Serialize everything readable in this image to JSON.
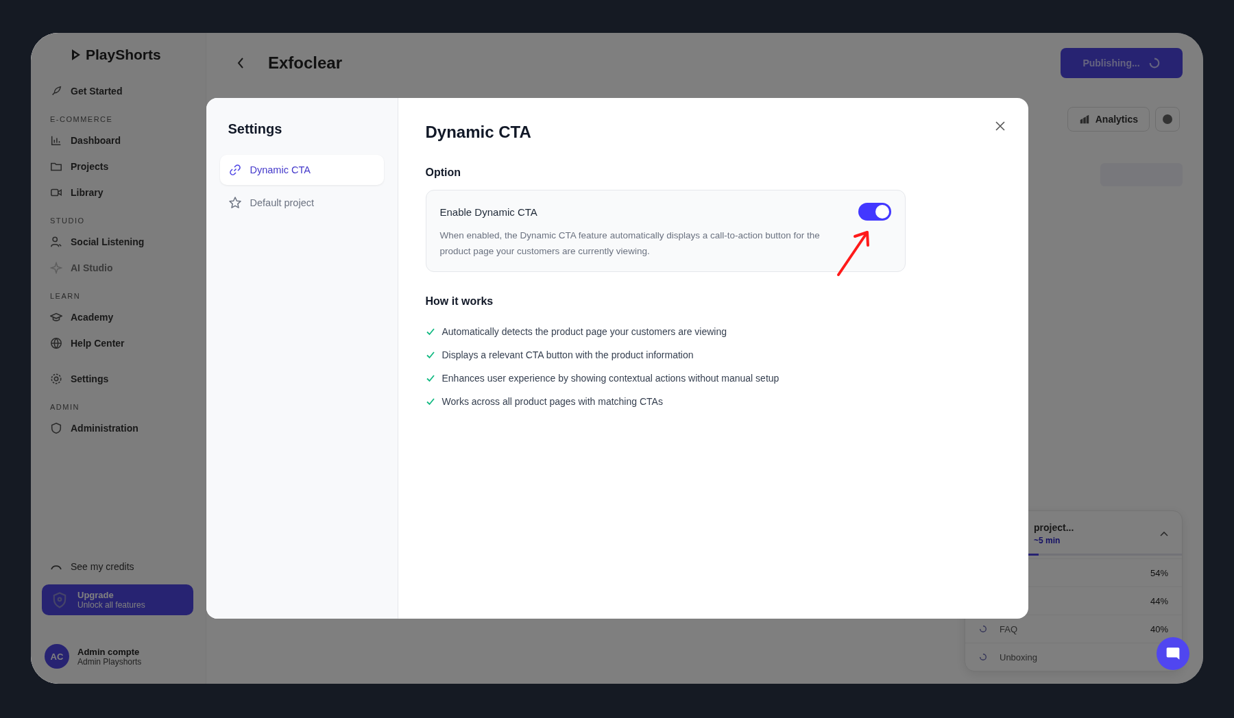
{
  "sidebar": {
    "logo": "PlayShorts",
    "nav": [
      {
        "kind": "item",
        "label": "Get Started",
        "disabled": false
      },
      {
        "kind": "heading",
        "label": "E-COMMERCE"
      },
      {
        "kind": "item",
        "label": "Dashboard",
        "disabled": false
      },
      {
        "kind": "item",
        "label": "Projects",
        "disabled": false
      },
      {
        "kind": "item",
        "label": "Library",
        "disabled": false
      },
      {
        "kind": "heading",
        "label": "STUDIO"
      },
      {
        "kind": "item",
        "label": "Social Listening",
        "disabled": false
      },
      {
        "kind": "item",
        "label": "AI Studio",
        "disabled": true
      },
      {
        "kind": "heading",
        "label": "LEARN"
      },
      {
        "kind": "item",
        "label": "Academy",
        "disabled": false
      },
      {
        "kind": "item",
        "label": "Help Center",
        "disabled": false
      },
      {
        "kind": "item",
        "label": "Settings",
        "disabled": false
      },
      {
        "kind": "heading",
        "label": "ADMIN"
      },
      {
        "kind": "item",
        "label": "Administration",
        "disabled": false
      }
    ],
    "credits": "See my credits",
    "upgrade": {
      "title": "Upgrade",
      "subtitle": "Unlock all features"
    },
    "user": {
      "initials": "AC",
      "name": "Admin compte",
      "subtitle": "Admin Playshorts"
    }
  },
  "header": {
    "title": "Exfoclear",
    "publish_button": "Publishing..."
  },
  "toolbar": {
    "analytics_button": "Analytics"
  },
  "progress_panel": {
    "title": "project...",
    "eta": "~5 min",
    "level": 0.34,
    "rows": [
      {
        "label": "",
        "value": "54%"
      },
      {
        "label": "",
        "value": "44%"
      },
      {
        "label": "FAQ",
        "value": "40%"
      },
      {
        "label": "Unboxing",
        "value": ""
      }
    ]
  },
  "modal": {
    "nav_title": "Settings",
    "nav": [
      {
        "label": "Dynamic CTA",
        "selected": true
      },
      {
        "label": "Default project",
        "selected": false
      }
    ],
    "title": "Dynamic CTA",
    "section": "Option",
    "option": {
      "label": "Enable Dynamic CTA",
      "on": true,
      "description": "When enabled, the Dynamic CTA feature automatically displays a call-to-action button for the product page your customers are currently viewing."
    },
    "how_title": "How it works",
    "points": [
      "Automatically detects the product page your customers are viewing",
      "Displays a relevant CTA button with the product information",
      "Enhances user experience by showing contextual actions without manual setup",
      "Works across all product pages with matching CTAs"
    ]
  }
}
